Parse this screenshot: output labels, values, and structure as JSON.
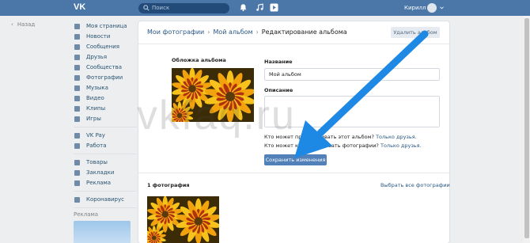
{
  "topbar": {
    "search_placeholder": "Поиск",
    "user_name": "Кирилл"
  },
  "back": {
    "label": "Назад"
  },
  "sidebar": {
    "group1": [
      {
        "label": "Моя страница",
        "icon": "home-icon"
      },
      {
        "label": "Новости",
        "icon": "news-icon"
      },
      {
        "label": "Сообщения",
        "icon": "messages-icon"
      },
      {
        "label": "Друзья",
        "icon": "friends-icon"
      },
      {
        "label": "Сообщества",
        "icon": "groups-icon"
      },
      {
        "label": "Фотографии",
        "icon": "photos-icon"
      },
      {
        "label": "Музыка",
        "icon": "music-icon"
      },
      {
        "label": "Видео",
        "icon": "video-icon"
      },
      {
        "label": "Клипы",
        "icon": "clips-icon"
      },
      {
        "label": "Игры",
        "icon": "games-icon"
      }
    ],
    "group2": [
      {
        "label": "VK Pay",
        "icon": "vkpay-icon"
      },
      {
        "label": "Работа",
        "icon": "work-icon"
      }
    ],
    "group3": [
      {
        "label": "Товары",
        "icon": "goods-icon"
      },
      {
        "label": "Закладки",
        "icon": "bookmarks-icon"
      },
      {
        "label": "Реклама",
        "icon": "ads-icon"
      }
    ],
    "group4": [
      {
        "label": "Коронавирус",
        "icon": "coronavirus-icon"
      }
    ],
    "ads_label": "Реклама"
  },
  "breadcrumb": {
    "items": [
      "Мои фотографии",
      "Мой альбом",
      "Редактирование альбома"
    ],
    "delete_label": "Удалить альбом"
  },
  "form": {
    "cover_label": "Обложка альбома",
    "name_label": "Название",
    "name_value": "Мой альбом",
    "description_label": "Описание",
    "privacy_view_q": "Кто может просматривать этот альбом?",
    "privacy_view_value": "Только друзья.",
    "privacy_comment_q": "Кто может комментировать фотографии?",
    "privacy_comment_value": "Только друзья.",
    "save_label": "Сохранить изменения"
  },
  "photos": {
    "count_label": "1 фотография",
    "select_all_label": "Выбрать все фотографии"
  },
  "watermark": "vkfaq.ru",
  "colors": {
    "header": "#4a76a8",
    "button": "#5181b8",
    "link": "#2a5885",
    "arrow": "#1e88e5"
  }
}
